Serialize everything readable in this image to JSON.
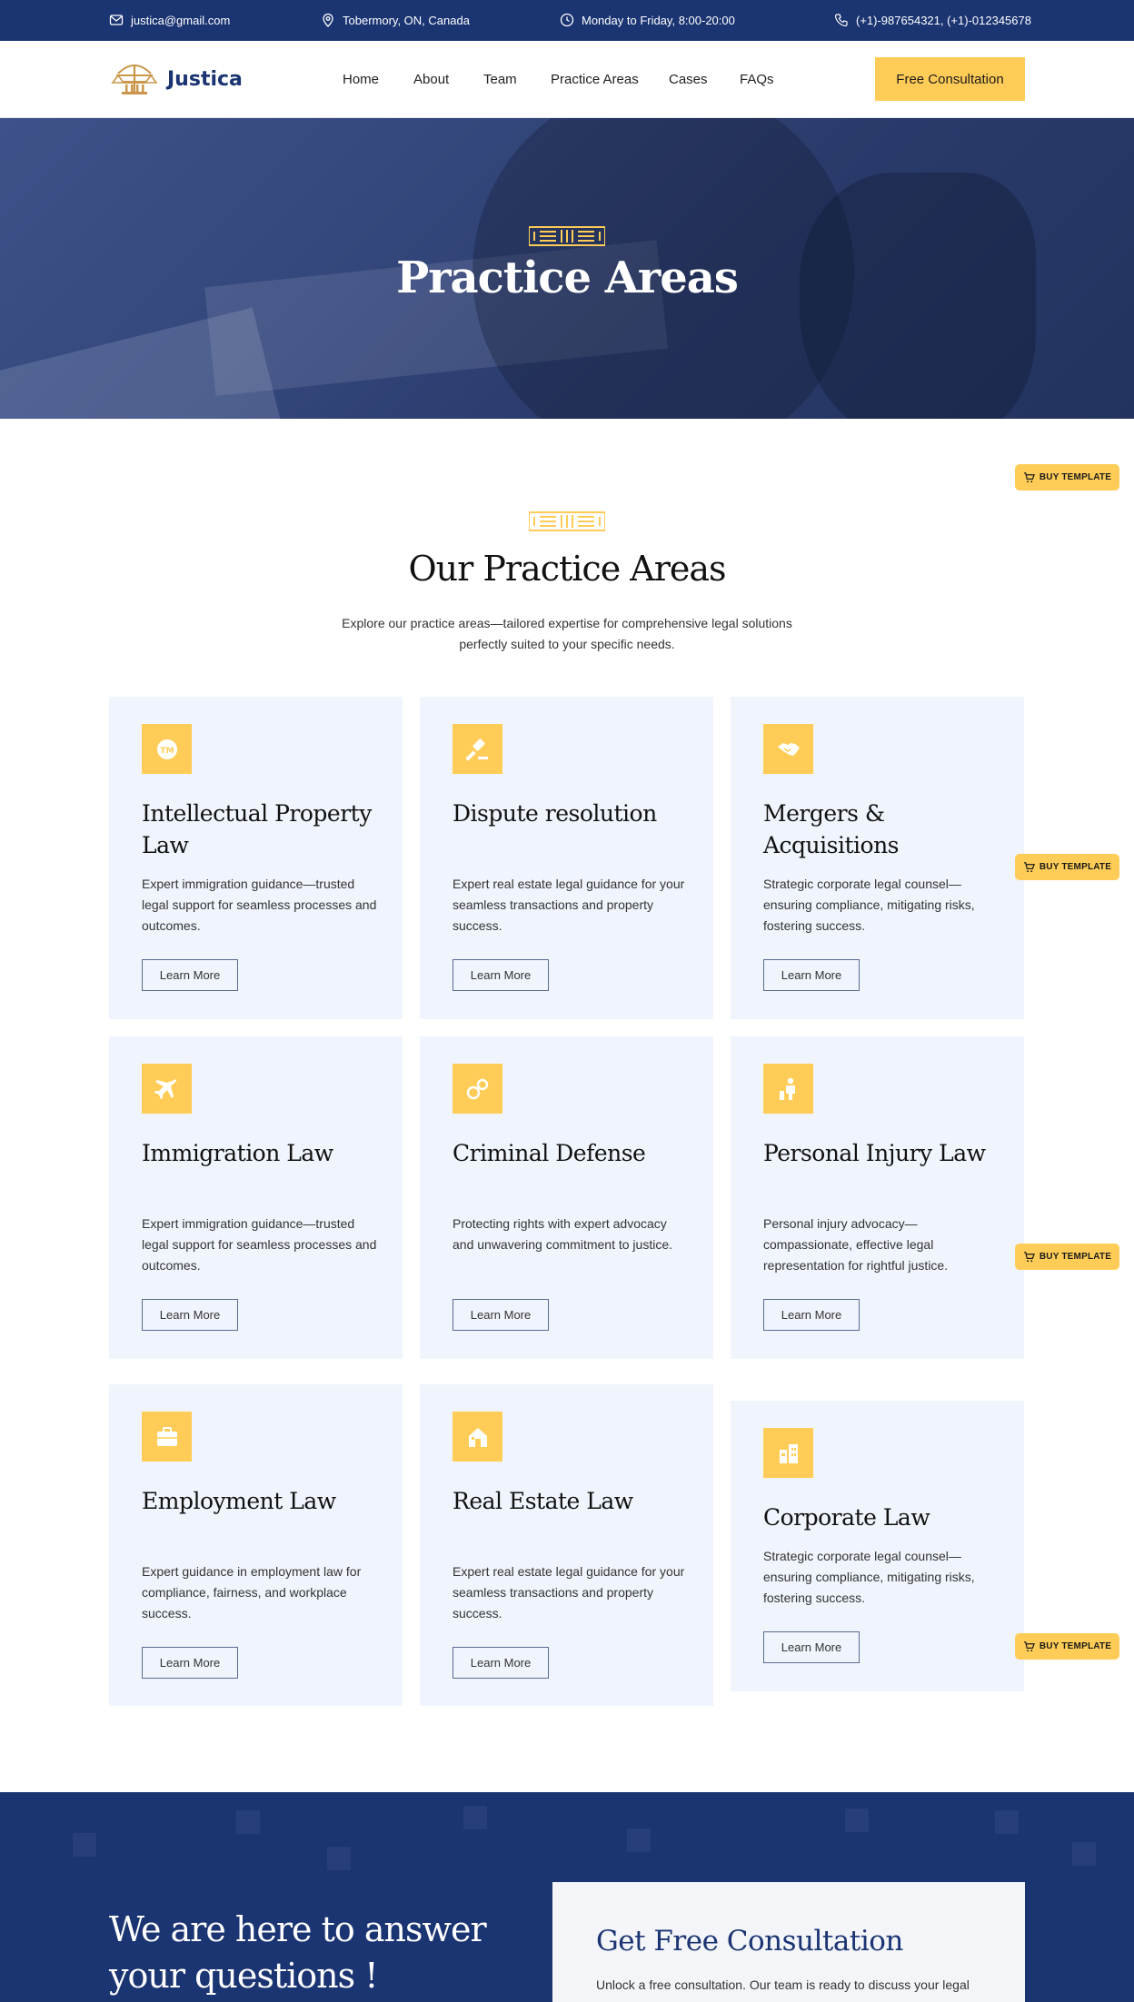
{
  "topbar": {
    "email": "justica@gmail.com",
    "location": "Tobermory, ON, Canada",
    "hours": "Monday to Friday, 8:00-20:00",
    "phone": "(+1)-987654321, (+1)-012345678"
  },
  "header": {
    "brand": "Justica",
    "nav": [
      "Home",
      "About",
      "Team",
      "Practice Areas",
      "Cases",
      "FAQs"
    ],
    "cta": "Free Consultation"
  },
  "hero": {
    "title": "Practice Areas"
  },
  "section": {
    "title": "Our Practice Areas",
    "subtitle": "Explore our practice areas—tailored expertise for comprehensive legal solutions perfectly suited to your specific needs."
  },
  "cards": [
    {
      "icon": "trademark-icon",
      "title": "Intellectual Property Law",
      "desc": "Expert immigration guidance—trusted legal support for seamless processes and outcomes.",
      "button": "Learn More"
    },
    {
      "icon": "gavel-icon",
      "title": "Dispute resolution",
      "desc": "Expert real estate legal guidance for your seamless transactions and property success.",
      "button": "Learn More"
    },
    {
      "icon": "handshake-icon",
      "title": "Mergers & Acquisitions",
      "desc": "Strategic corporate legal counsel—ensuring compliance, mitigating risks, fostering success.",
      "button": "Learn More"
    },
    {
      "icon": "airplane-icon",
      "title": "Immigration Law",
      "desc": "Expert immigration guidance—trusted legal support for seamless processes and outcomes.",
      "button": "Learn More"
    },
    {
      "icon": "handcuffs-icon",
      "title": "Criminal Defense",
      "desc": "Protecting rights with expert advocacy and unwavering commitment to justice.",
      "button": "Learn More"
    },
    {
      "icon": "injured-person-icon",
      "title": "Personal Injury Law",
      "desc": "Personal injury advocacy—compassionate, effective legal representation for rightful justice.",
      "button": "Learn More"
    },
    {
      "icon": "briefcase-icon",
      "title": "Employment Law",
      "desc": "Expert guidance in employment law for compliance, fairness, and workplace success.",
      "button": "Learn More"
    },
    {
      "icon": "house-icon",
      "title": "Real Estate Law",
      "desc": "Expert real estate legal guidance for your seamless transactions and property success.",
      "button": "Learn More"
    },
    {
      "icon": "buildings-icon",
      "title": "Corporate Law",
      "desc": "Strategic corporate legal counsel—ensuring compliance, mitigating risks, fostering success.",
      "button": "Learn More"
    }
  ],
  "buy_template": "BUY TEMPLATE",
  "bottom": {
    "title": "We are here to answer your questions !",
    "consult_title": "Get Free Consultation",
    "consult_text": "Unlock a free consultation. Our team is ready to discuss your legal"
  },
  "colors": {
    "navy": "#1b3472",
    "accent": "#ffcd57",
    "card_bg": "#f0f4fc"
  }
}
